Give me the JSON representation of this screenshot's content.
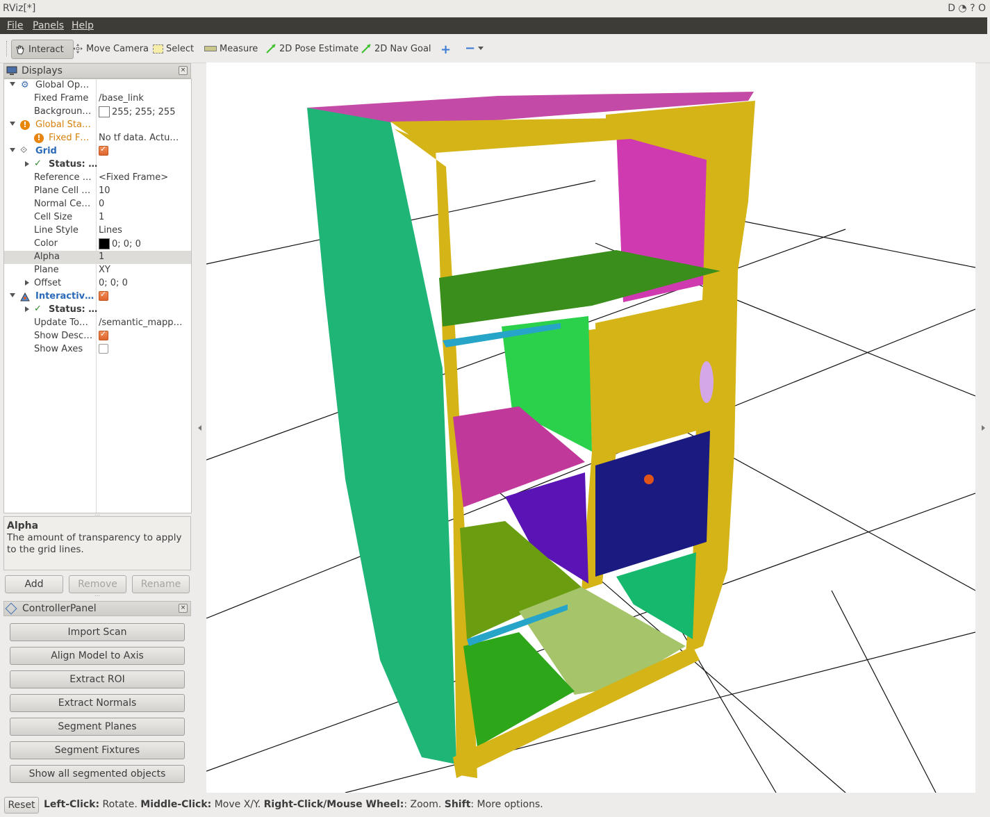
{
  "window": {
    "title": "RViz[*]",
    "controls": "D ◔ ? O"
  },
  "menu": [
    "File",
    "Panels",
    "Help"
  ],
  "toolbar": {
    "interact": "Interact",
    "move_camera": "Move Camera",
    "select": "Select",
    "measure": "Measure",
    "pose_estimate": "2D Pose Estimate",
    "nav_goal": "2D Nav Goal"
  },
  "displays": {
    "title": "Displays",
    "rows": [
      {
        "key": "Global Op…",
        "value": ""
      },
      {
        "key": "Fixed Frame",
        "value": "/base_link"
      },
      {
        "key": "Backgroun…",
        "value": "255; 255; 255"
      },
      {
        "key": "Global Sta…",
        "value": ""
      },
      {
        "key": "Fixed F…",
        "value": "No tf data.  Actu…"
      },
      {
        "key": "Grid",
        "value": ""
      },
      {
        "key": "Status: …",
        "value": ""
      },
      {
        "key": "Reference …",
        "value": "<Fixed Frame>"
      },
      {
        "key": "Plane Cell …",
        "value": "10"
      },
      {
        "key": "Normal Ce…",
        "value": "0"
      },
      {
        "key": "Cell Size",
        "value": "1"
      },
      {
        "key": "Line Style",
        "value": "Lines"
      },
      {
        "key": "Color",
        "value": "0; 0; 0"
      },
      {
        "key": "Alpha",
        "value": "1"
      },
      {
        "key": "Plane",
        "value": "XY"
      },
      {
        "key": "Offset",
        "value": "0; 0; 0"
      },
      {
        "key": "Interactiv…",
        "value": ""
      },
      {
        "key": "Status: …",
        "value": ""
      },
      {
        "key": "Update To…",
        "value": "/semantic_mapp…"
      },
      {
        "key": "Show Desc…",
        "value": ""
      },
      {
        "key": "Show Axes",
        "value": ""
      }
    ],
    "description_title": "Alpha",
    "description_text": "The amount of transparency to apply to the grid lines.",
    "buttons": {
      "add": "Add",
      "remove": "Remove",
      "rename": "Rename"
    }
  },
  "controller": {
    "title": "ControllerPanel",
    "buttons": [
      "Import Scan",
      "Align Model to Axis",
      "Extract ROI",
      "Extract Normals",
      "Segment Planes",
      "Segment Fixtures",
      "Show all segmented objects"
    ]
  },
  "status": {
    "reset": "Reset",
    "b1": "Left-Click:",
    "t1": " Rotate. ",
    "b2": "Middle-Click:",
    "t2": " Move X/Y. ",
    "b3": "Right-Click/Mouse Wheel:",
    "t3": ": Zoom. ",
    "b4": "Shift",
    "t4": ": More options."
  },
  "colors": {
    "menubar": "#3d3c37",
    "accent_orange": "#e0652e",
    "link_blue": "#2a6ab8"
  }
}
